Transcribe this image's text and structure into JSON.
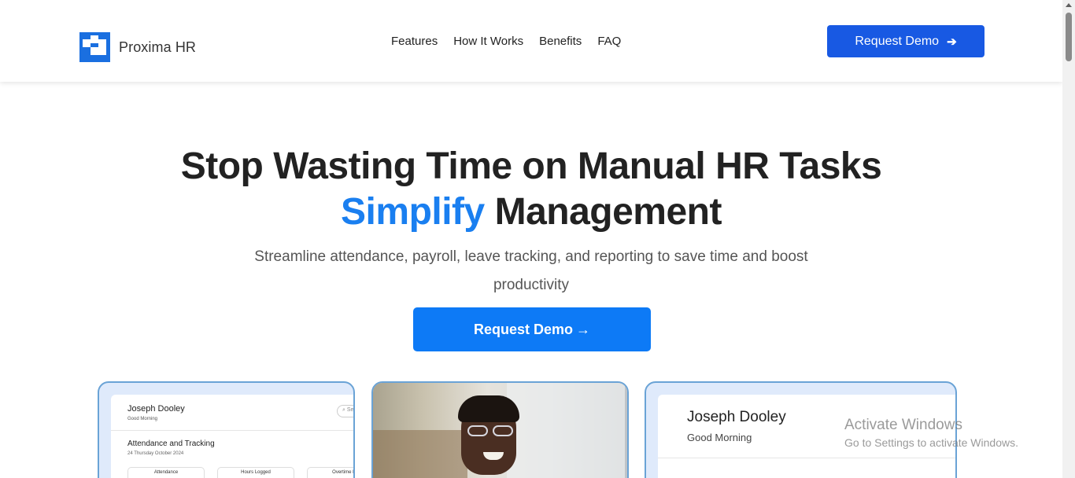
{
  "header": {
    "brand": "Proxima HR",
    "logo_icon": "proxima-checker-logo",
    "nav": [
      "Features",
      "How It Works",
      "Benefits",
      "FAQ"
    ],
    "cta_label": "Request Demo",
    "cta_icon": "arrow-right-icon",
    "cta_color": "#1859e3"
  },
  "hero": {
    "title_line1": "Stop Wasting Time on Manual HR Tasks",
    "title_accent": "Simplify",
    "title_rest": "Management",
    "accent_color": "#1a7ff0",
    "subtitle": "Streamline attendance, payroll, leave tracking, and reporting to save time and boost productivity",
    "cta_label": "Request Demo",
    "cta_arrow": "→",
    "cta_color": "#0d7af6"
  },
  "preview_cards": {
    "card1": {
      "name": "Joseph Dooley",
      "greeting": "Good Morning",
      "search_placeholder": "Se",
      "section_title": "Attendance and Tracking",
      "date": "24 Thursday October 2024",
      "pills": [
        "Attendance",
        "Hours Logged",
        "Overtime Ho"
      ]
    },
    "card2": {
      "image_desc": "smiling-woman-photo"
    },
    "card3": {
      "name": "Joseph Dooley",
      "greeting": "Good Morning"
    }
  },
  "watermark": {
    "title": "Activate Windows",
    "subtitle": "Go to Settings to activate Windows."
  }
}
